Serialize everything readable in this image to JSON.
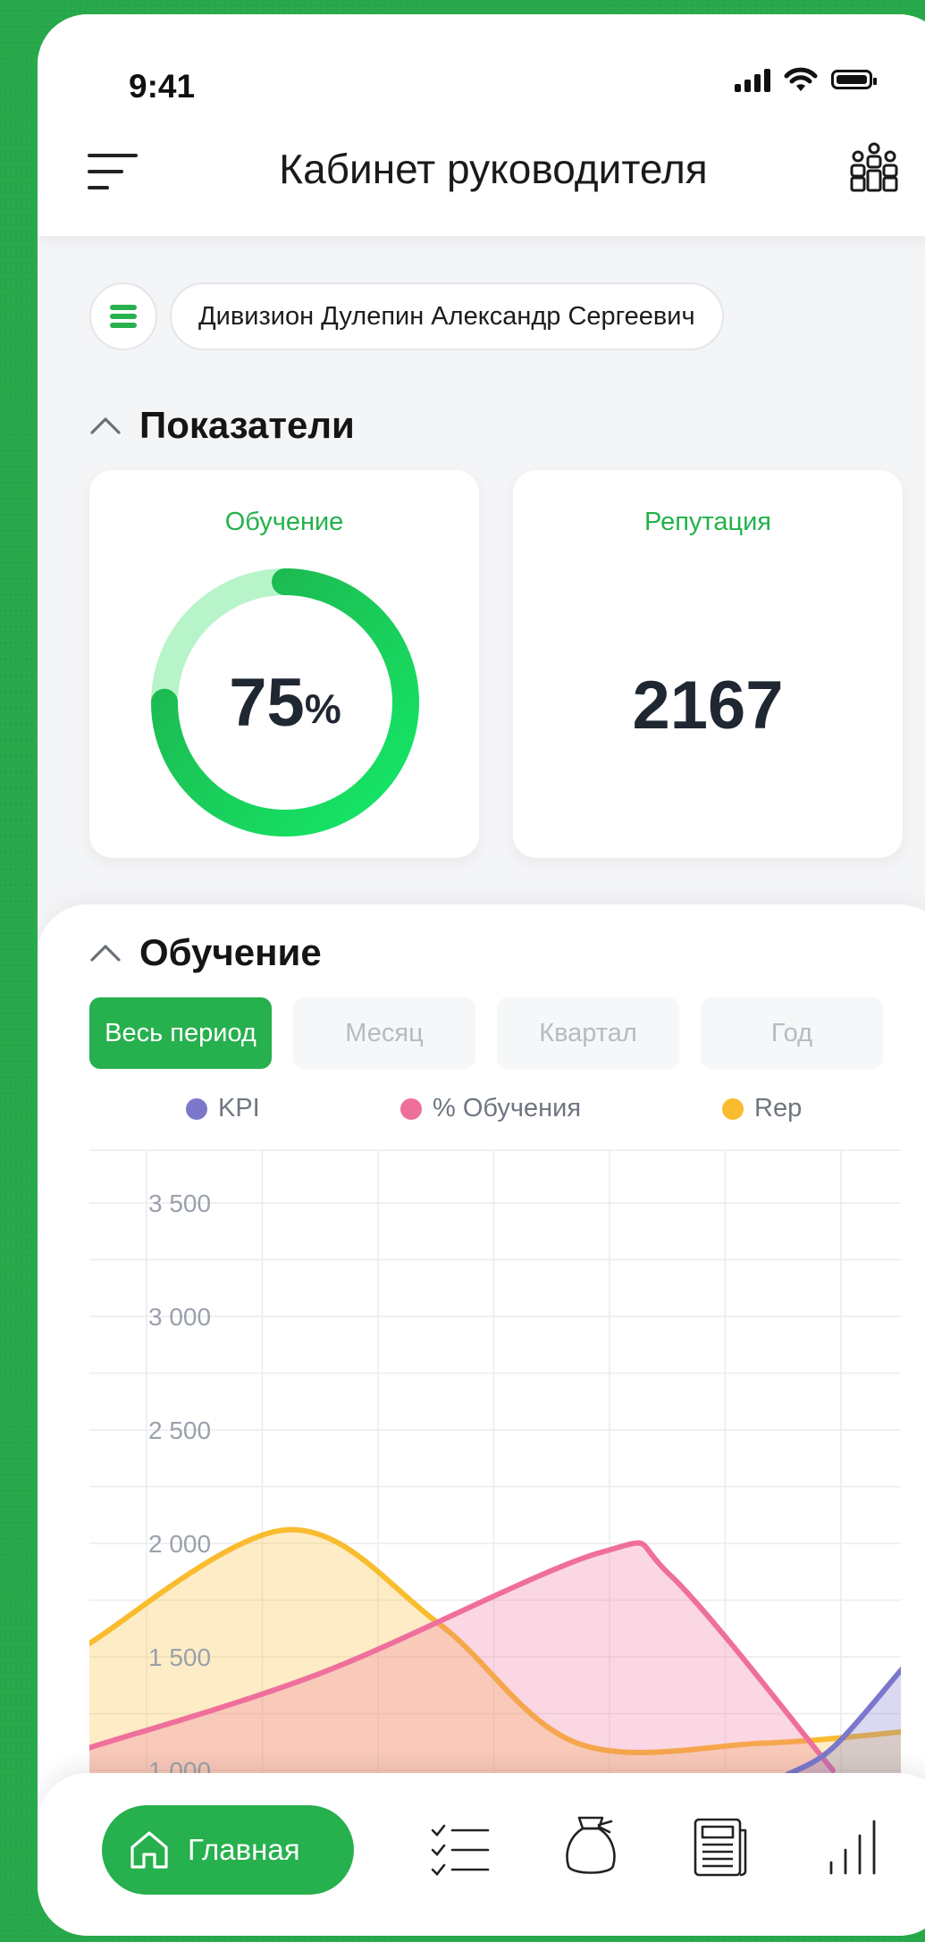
{
  "status": {
    "time": "9:41"
  },
  "header": {
    "title": "Кабинет руководителя"
  },
  "filter": {
    "chip": "Дивизион Дулепин Александр Сергеевич"
  },
  "indicators": {
    "section_title": "Показатели",
    "learning": {
      "label": "Обучение",
      "value": "75",
      "unit": "%",
      "progress": 0.75
    },
    "reputation": {
      "label": "Репутация",
      "value": "2167"
    }
  },
  "learning_section": {
    "title": "Обучение",
    "tabs": [
      "Весь период",
      "Месяц",
      "Квартал",
      "Год"
    ],
    "active_tab": 0
  },
  "legend": [
    {
      "name": "KPI",
      "color": "#7b78cc"
    },
    {
      "name": "% Обучения",
      "color": "#ef6f9c"
    },
    {
      "name": "Rep",
      "color": "#f9bc2e"
    }
  ],
  "chart_data": {
    "type": "area",
    "y_ticks": [
      "3 500",
      "3 000",
      "2 500",
      "2 000",
      "1 500",
      "1 000"
    ],
    "ylim": [
      1000,
      3500
    ],
    "grid": true,
    "series": [
      {
        "name": "Rep",
        "color": "#f9bc2e",
        "values": [
          [
            0,
            1560
          ],
          [
            1.7,
            2060
          ],
          [
            3.0,
            1650
          ],
          [
            4.2,
            1120
          ],
          [
            5.8,
            1120
          ],
          [
            7.0,
            1170
          ]
        ]
      },
      {
        "name": "% Обучения",
        "color": "#ef6f9c",
        "values": [
          [
            0,
            1100
          ],
          [
            2.0,
            1430
          ],
          [
            4.4,
            1960
          ],
          [
            5.0,
            1860
          ],
          [
            6.4,
            1000
          ]
        ]
      },
      {
        "name": "KPI",
        "color": "#7b78cc",
        "values": [
          [
            6.0,
            980
          ],
          [
            6.4,
            1100
          ],
          [
            7.0,
            1450
          ]
        ]
      }
    ]
  },
  "nav": {
    "home_label": "Главная"
  }
}
